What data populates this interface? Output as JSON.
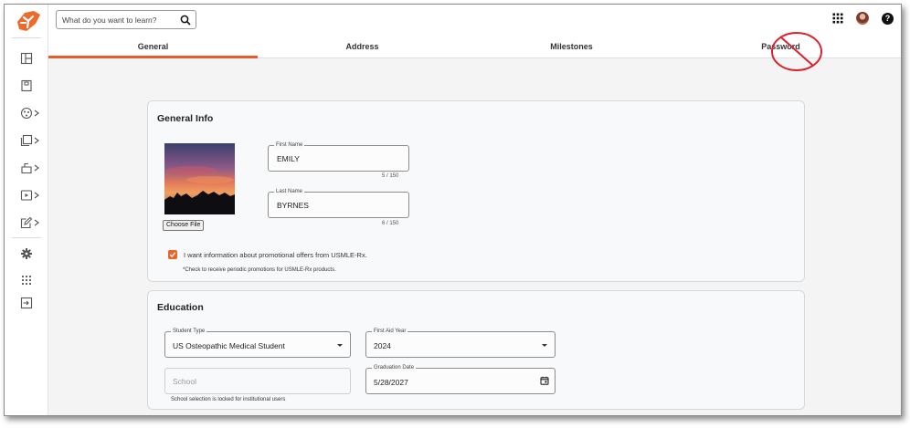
{
  "search": {
    "placeholder": "What do you want to learn?"
  },
  "tabs": [
    {
      "label": "General",
      "active": true
    },
    {
      "label": "Address",
      "active": false
    },
    {
      "label": "Milestones",
      "active": false
    },
    {
      "label": "Password",
      "active": false
    }
  ],
  "sidebar": {
    "items": [
      {
        "icon": "dashboard-icon"
      },
      {
        "icon": "notebook-icon"
      },
      {
        "icon": "qbank-icon",
        "expandable": true
      },
      {
        "icon": "flashcards-icon",
        "expandable": true
      },
      {
        "icon": "lab-values-icon",
        "expandable": true
      },
      {
        "icon": "video-icon",
        "expandable": true
      },
      {
        "icon": "edit-icon",
        "expandable": true
      },
      {
        "icon": "gear-icon"
      },
      {
        "icon": "apps-grid-icon"
      },
      {
        "icon": "logout-icon"
      }
    ]
  },
  "general_info": {
    "title": "General Info",
    "choose_file_label": "Choose File",
    "first_name": {
      "label": "First Name",
      "value": "EMILY",
      "counter": "5 / 150"
    },
    "last_name": {
      "label": "Last Name",
      "value": "BYRNES",
      "counter": "6 / 150"
    },
    "promo": {
      "checked": true,
      "label": "I want information about promotional offers from USMLE-Rx.",
      "note": "*Check to receive periodic promotions for USMLE-Rx products."
    }
  },
  "education": {
    "title": "Education",
    "student_type": {
      "label": "Student Type",
      "value": "US Osteopathic Medical Student"
    },
    "first_aid_year": {
      "label": "First Aid Year",
      "value": "2024"
    },
    "school": {
      "placeholder": "School",
      "helper": "School selection is locked for institutional users"
    },
    "graduation_date": {
      "label": "Graduation Date",
      "value": "5/28/2027"
    }
  },
  "colors": {
    "accent": "#e85b2a",
    "annotation": "#d9232e"
  }
}
